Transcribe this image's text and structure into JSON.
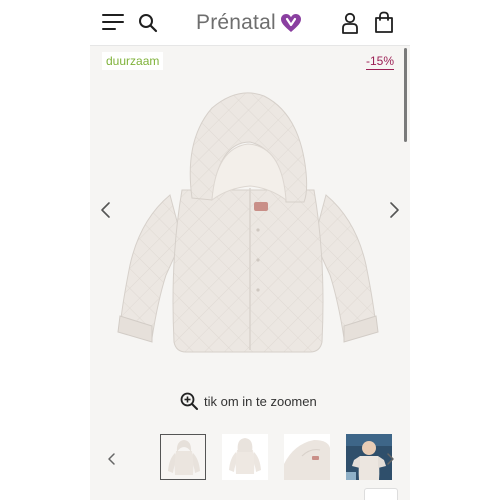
{
  "header": {
    "brand": "Prénatal",
    "brand_color": "#8a3fa0",
    "icons": [
      "menu-icon",
      "search-icon",
      "account-icon",
      "shopping-bag-icon"
    ]
  },
  "badges": {
    "sustainable": "duurzaam",
    "sustainable_color": "#7fb23a",
    "discount": "-15%",
    "discount_color": "#9b1f54"
  },
  "gallery": {
    "zoom_hint": "tik om in te zoomen",
    "thumbnail_count": 4,
    "active_thumbnail": 1
  },
  "colors": {
    "page_background": "#f6f5f3",
    "jacket": "#e9e4df"
  }
}
